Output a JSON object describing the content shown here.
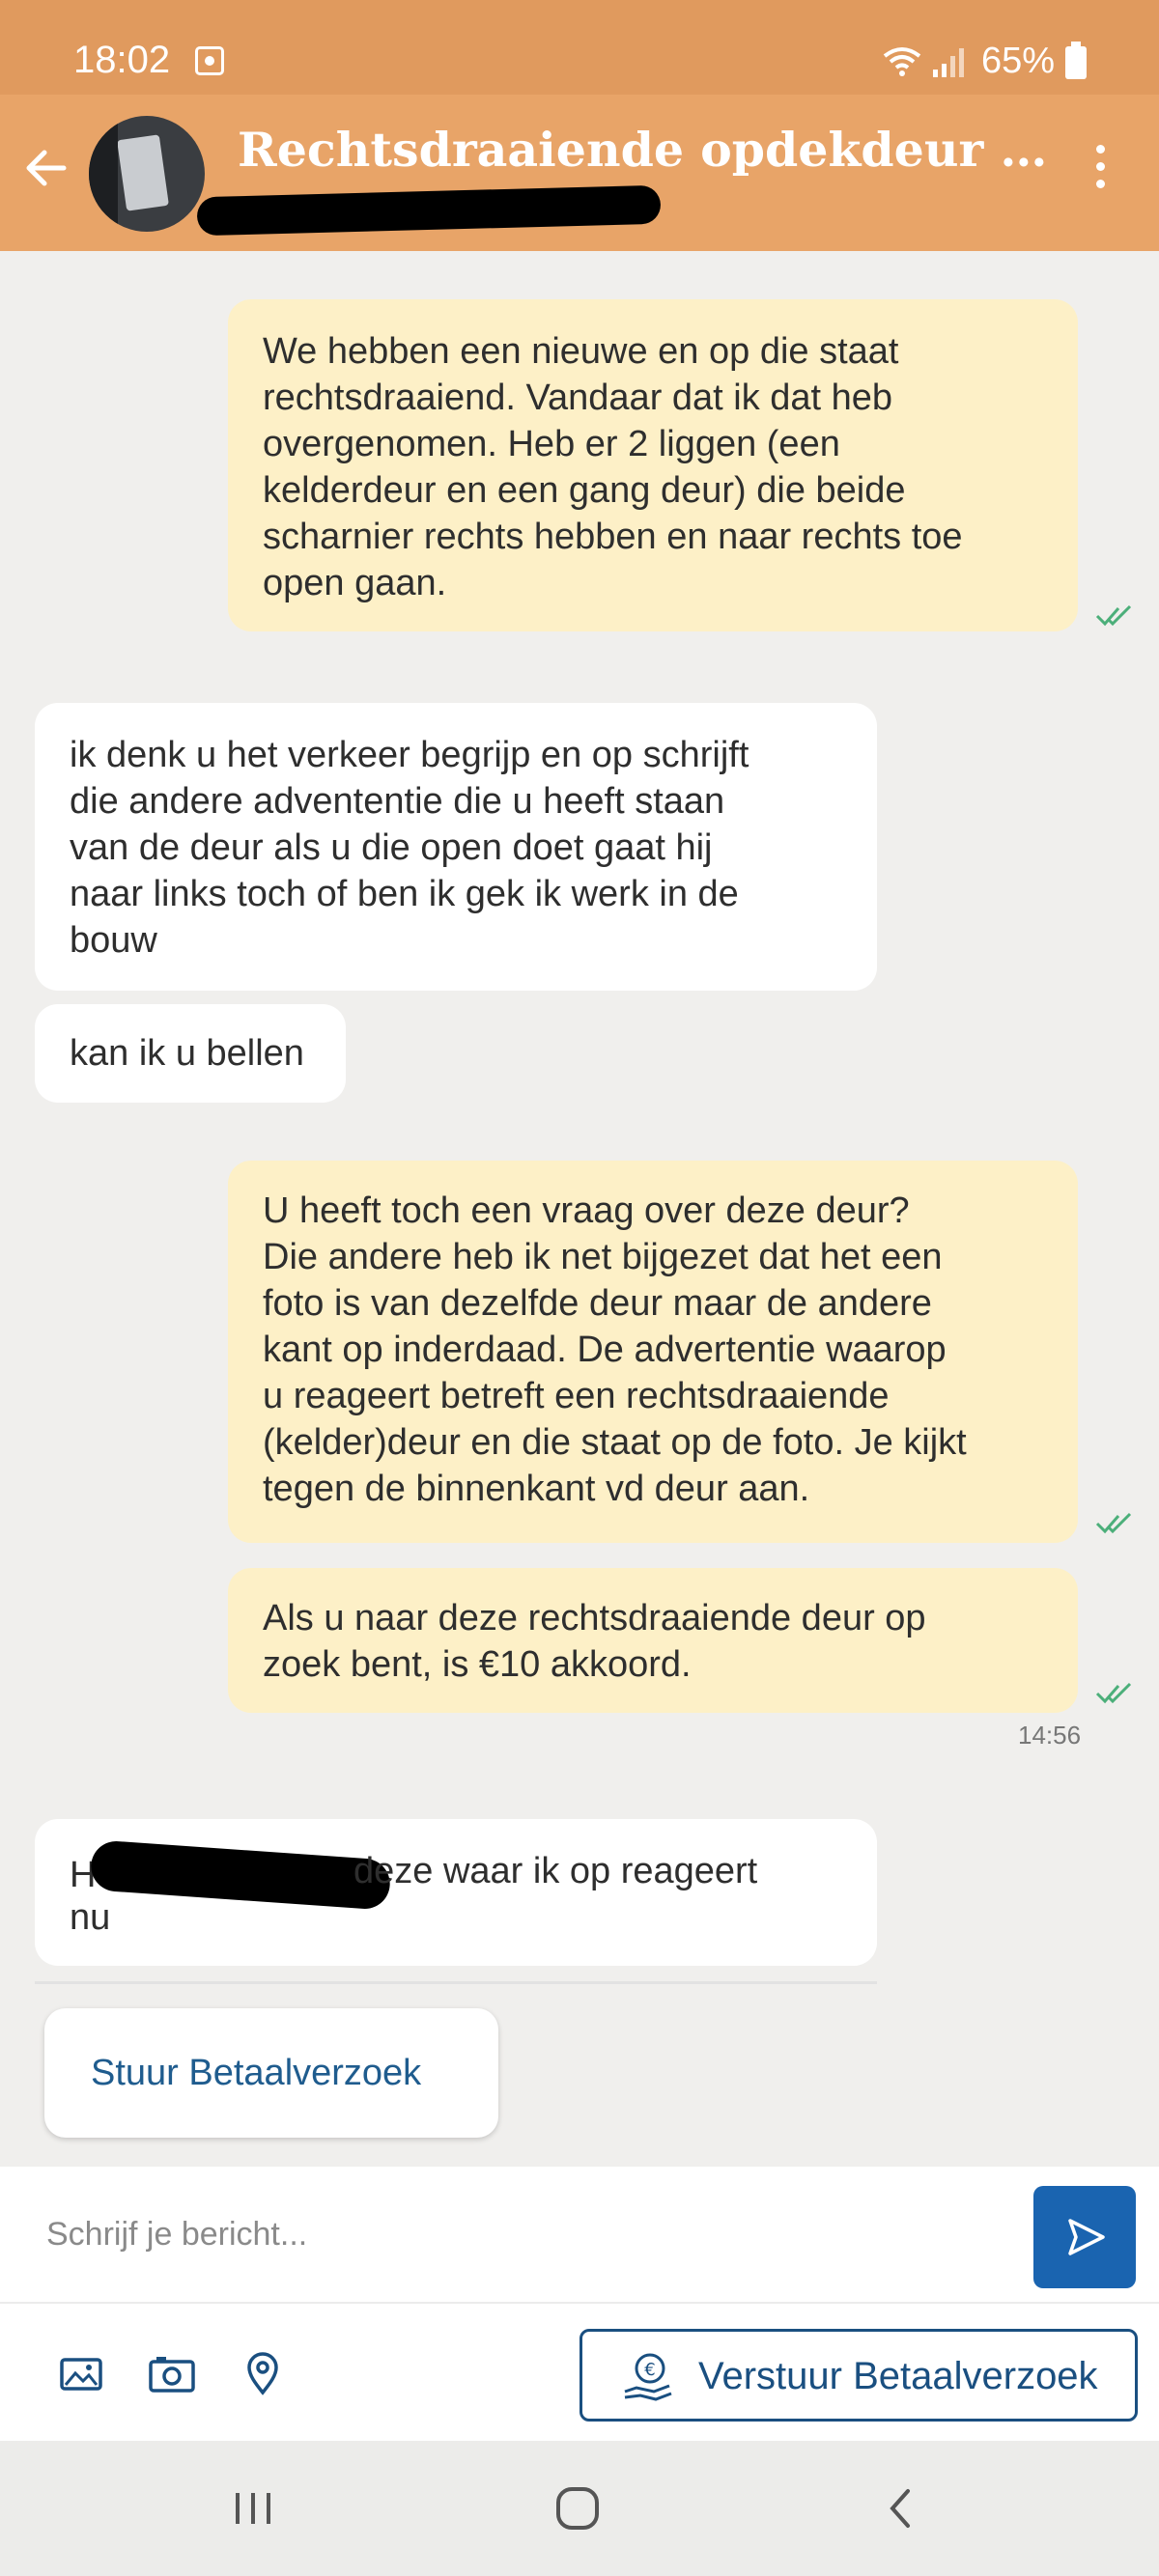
{
  "status_bar": {
    "time": "18:02",
    "battery": "65%"
  },
  "header": {
    "title": "Rechtsdraaiende opdekdeur 7..."
  },
  "messages": [
    {
      "direction": "out",
      "text": "We hebben een nieuwe en op die staat\nrechtsdraaiend. Vandaar dat ik dat heb\novergenomen. Heb er 2 liggen (een\nkelderdeur en een gang deur) die beide\nscharnier rechts hebben en naar rechts toe\nopen gaan."
    },
    {
      "direction": "in",
      "text": "ik denk u het verkeer begrijp en op schrijft\ndie andere advententie die u heeft staan\nvan de deur als u die open doet gaat hij\nnaar links toch of ben ik gek ik werk in de\nbouw"
    },
    {
      "direction": "in",
      "text": "kan ik u bellen"
    },
    {
      "direction": "out",
      "text": "U heeft toch een vraag over deze deur?\nDie andere heb ik net bijgezet dat het een\nfoto is van dezelfde deur maar de andere\nkant op inderdaad. De advertentie waarop\nu reageert betreft een rechtsdraaiende\n(kelder)deur en die staat op de foto. Je kijkt\ntegen de binnenkant vd deur aan."
    },
    {
      "direction": "out",
      "text": "Als u naar deze rechtsdraaiende deur op\nzoek bent, is €10 akkoord.",
      "time": "14:56"
    },
    {
      "direction": "in",
      "prefix": "H",
      "text_line1": "deze waar ik op reageert",
      "text_line2": "nu"
    }
  ],
  "pay_request_card": {
    "label": "Stuur Betaalverzoek"
  },
  "composer": {
    "placeholder": "Schrijf je bericht..."
  },
  "toolbar": {
    "send_payment_label": "Verstuur Betaalverzoek"
  },
  "colors": {
    "header": "#e8a468",
    "status_bar": "#e09a5e",
    "bubble_out": "#fdf0c7",
    "bubble_in": "#ffffff",
    "accent": "#1a64b0",
    "read_check": "#4caf7a"
  }
}
